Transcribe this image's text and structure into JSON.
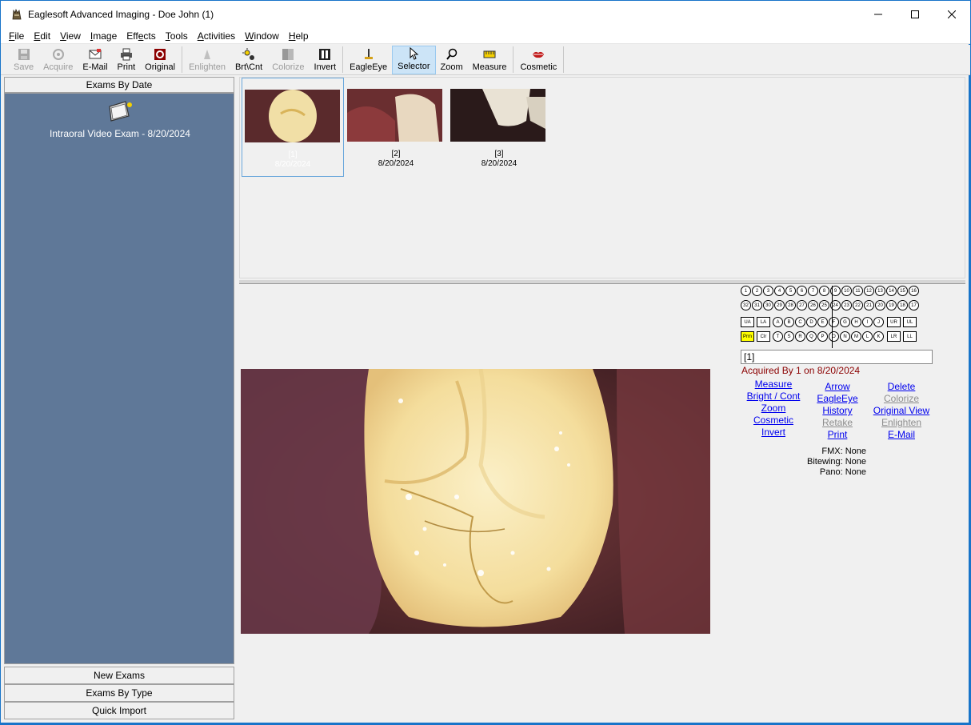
{
  "window": {
    "title": "Eaglesoft Advanced Imaging - Doe John (1)"
  },
  "menu": [
    {
      "pre": "",
      "acc": "F",
      "post": "ile"
    },
    {
      "pre": "",
      "acc": "E",
      "post": "dit"
    },
    {
      "pre": "",
      "acc": "V",
      "post": "iew"
    },
    {
      "pre": "",
      "acc": "I",
      "post": "mage"
    },
    {
      "pre": "Eff",
      "acc": "e",
      "post": "cts"
    },
    {
      "pre": "",
      "acc": "T",
      "post": "ools"
    },
    {
      "pre": "",
      "acc": "A",
      "post": "ctivities"
    },
    {
      "pre": "",
      "acc": "W",
      "post": "indow"
    },
    {
      "pre": "",
      "acc": "H",
      "post": "elp"
    }
  ],
  "toolbar": {
    "save": "Save",
    "acquire": "Acquire",
    "email": "E-Mail",
    "print": "Print",
    "original": "Original",
    "enlighten": "Enlighten",
    "brtcnt": "Brt\\Cnt",
    "colorize": "Colorize",
    "invert": "Invert",
    "eagleeye": "EagleEye",
    "selector": "Selector",
    "zoom": "Zoom",
    "measure": "Measure",
    "cosmetic": "Cosmetic"
  },
  "left_panel": {
    "header": "Exams By Date",
    "exam_label": "Intraoral Video Exam - 8/20/2024",
    "new_exams": "New Exams",
    "exams_by_type": "Exams By Type",
    "quick_import": "Quick Import"
  },
  "thumbnails": [
    {
      "label": "[1]",
      "date": "8/20/2024",
      "selected": true
    },
    {
      "label": "[2]",
      "date": "8/20/2024",
      "selected": false
    },
    {
      "label": "[3]",
      "date": "8/20/2024",
      "selected": false
    }
  ],
  "tooth_chart": {
    "upper": [
      "1",
      "2",
      "3",
      "4",
      "5",
      "6",
      "7",
      "8",
      "9",
      "10",
      "11",
      "12",
      "13",
      "14",
      "15",
      "16"
    ],
    "lower": [
      "32",
      "31",
      "30",
      "29",
      "28",
      "27",
      "26",
      "25",
      "24",
      "23",
      "22",
      "21",
      "20",
      "19",
      "18",
      "17"
    ],
    "primary_upper": [
      "A",
      "B",
      "C",
      "D",
      "E",
      "F",
      "G",
      "H",
      "I",
      "J"
    ],
    "primary_lower": [
      "T",
      "S",
      "R",
      "Q",
      "P",
      "O",
      "N",
      "M",
      "L",
      "K"
    ],
    "quad_left_upper": [
      "UA",
      "LA"
    ],
    "quad_left_lower": [
      "Prm",
      "Clr"
    ],
    "quad_right_upper": [
      "UR",
      "UL"
    ],
    "quad_right_lower": [
      "LR",
      "LL"
    ]
  },
  "viewer": {
    "image_id": "[1]",
    "acquired": "Acquired By 1 on 8/20/2024",
    "links_col1": [
      "Measure",
      "Bright / Cont",
      "Zoom",
      "Cosmetic",
      "Invert"
    ],
    "links_col2": [
      "Arrow",
      "EagleEye",
      "History",
      "Retake",
      "Print"
    ],
    "links_col3": [
      "Delete",
      "Colorize",
      "Original View",
      "Enlighten",
      "E-Mail"
    ],
    "fmx": "FMX: None",
    "bitewing": "Bitewing: None",
    "pano": "Pano: None"
  },
  "colors": {
    "panel_blue": "#5f7898",
    "link": "#0000ee",
    "acquired_text": "#8b0000",
    "highlight_yellow": "#ffff00"
  }
}
